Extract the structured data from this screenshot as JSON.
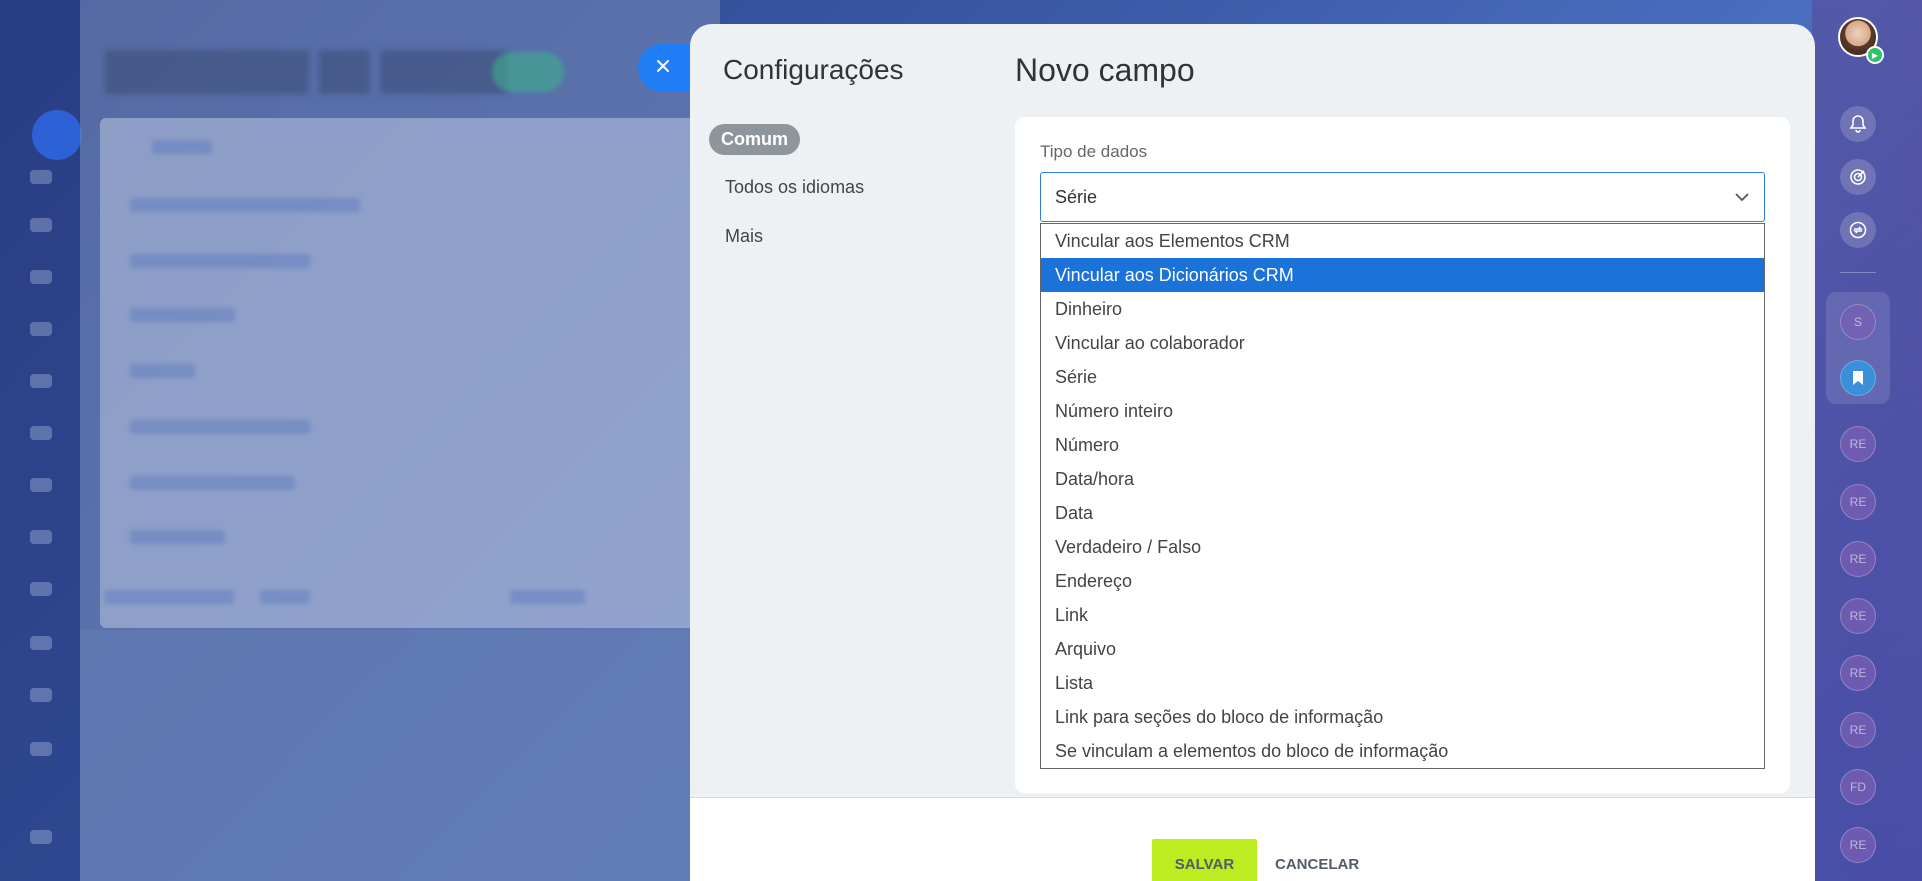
{
  "modal": {
    "left_title": "Configurações",
    "nav": [
      "Comum",
      "Todos os idiomas",
      "Mais"
    ],
    "title": "Novo campo"
  },
  "field": {
    "label": "Tipo de dados",
    "selected_value": "Série"
  },
  "dropdown": {
    "options": [
      "Vincular aos Elementos CRM",
      "Vincular aos Dicionários CRM",
      "Dinheiro",
      "Vincular ao colaborador",
      "Série",
      "Número inteiro",
      "Número",
      "Data/hora",
      "Data",
      "Verdadeiro / Falso",
      "Endereço",
      "Link",
      "Arquivo",
      "Lista",
      "Link para seções do bloco de informação",
      "Se vinculam a elementos do bloco de informação"
    ],
    "highlighted_option": "Vincular aos Dicionários CRM"
  },
  "footer": {
    "save_label": "SALVAR",
    "cancel_label": "CANCELAR"
  },
  "right_rail": {
    "bubbles": [
      "S",
      "RE",
      "RE",
      "RE",
      "RE",
      "RE",
      "RE",
      "FD",
      "RE"
    ]
  },
  "colors": {
    "accent_blue": "#1b72d9",
    "save_green": "#bbed21",
    "close_blue": "#1f7ef5"
  }
}
